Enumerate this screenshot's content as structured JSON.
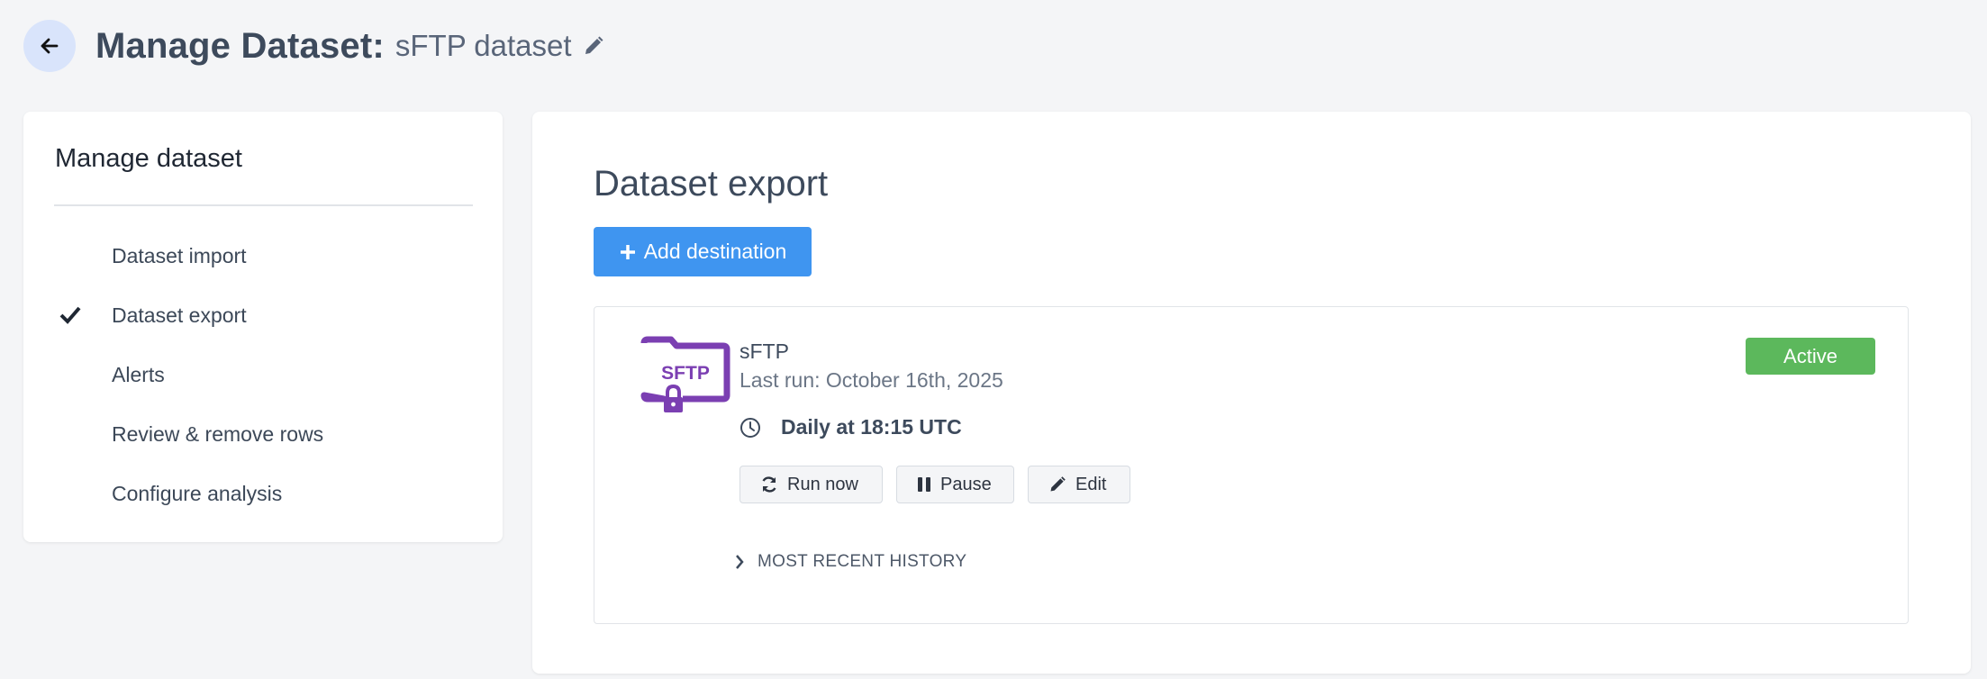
{
  "header": {
    "title": "Manage Dataset:",
    "dataset_name": "sFTP dataset",
    "back_icon": "arrow-left-icon",
    "edit_icon": "pencil-icon"
  },
  "sidebar": {
    "title": "Manage dataset",
    "items": [
      {
        "label": "Dataset import",
        "active": false
      },
      {
        "label": "Dataset export",
        "active": true
      },
      {
        "label": "Alerts",
        "active": false
      },
      {
        "label": "Review & remove rows",
        "active": false
      },
      {
        "label": "Configure analysis",
        "active": false
      }
    ]
  },
  "main": {
    "title": "Dataset export",
    "add_button": "Add destination",
    "destination": {
      "logo_text": "SFTP",
      "name": "sFTP",
      "last_run": "Last run: October 16th, 2025",
      "schedule": "Daily at 18:15 UTC",
      "status": "Active",
      "actions": {
        "run_now": "Run now",
        "pause": "Pause",
        "edit": "Edit"
      },
      "history_label": "MOST RECENT HISTORY"
    }
  },
  "colors": {
    "primary": "#3f95f0",
    "active_status": "#5cb85c",
    "sftp_purple": "#7b3fb2",
    "back_button_bg": "#d9e4fb"
  }
}
